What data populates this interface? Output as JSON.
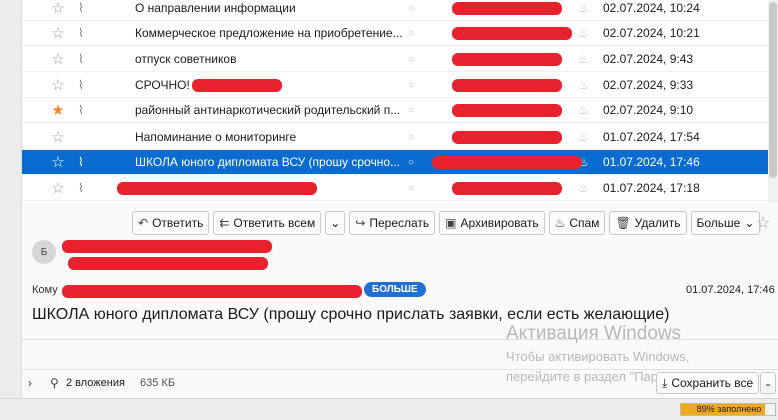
{
  "messages": [
    {
      "subject": "О направлении информации",
      "date": "02.07.2024, 10:24",
      "starred": false,
      "attachment": true,
      "selected": false
    },
    {
      "subject": "Коммерческое предложение на приобретение...",
      "date": "02.07.2024, 10:21",
      "starred": false,
      "attachment": true,
      "selected": false
    },
    {
      "subject": "отпуск советников",
      "date": "02.07.2024, 9:43",
      "starred": false,
      "attachment": true,
      "selected": false
    },
    {
      "subject": "СРОЧНО!",
      "date": "02.07.2024, 9:33",
      "starred": false,
      "attachment": true,
      "selected": false
    },
    {
      "subject": "районный антинаркотический родительский п...",
      "date": "02.07.2024, 9:10",
      "starred": true,
      "attachment": true,
      "selected": false
    },
    {
      "subject": "Напоминание о мониторинге",
      "date": "01.07.2024, 17:54",
      "starred": false,
      "attachment": false,
      "selected": false
    },
    {
      "subject": "ШКОЛА юного дипломата ВСУ (прошу срочно...",
      "date": "01.07.2024, 17:46",
      "starred": false,
      "attachment": true,
      "selected": true
    },
    {
      "subject": "",
      "date": "01.07.2024, 17:18",
      "starred": false,
      "attachment": true,
      "selected": false
    }
  ],
  "toolbar": {
    "reply": "Ответить",
    "reply_all": "Ответить всем",
    "forward": "Переслать",
    "archive": "Архивировать",
    "spam": "Спам",
    "delete": "Удалить",
    "more": "Больше"
  },
  "header": {
    "avatar_letter": "Б",
    "to_label": "Кому",
    "more_badge": "БОЛЬШЕ",
    "date": "01.07.2024, 17:46",
    "subject": "ШКОЛА юного дипломата ВСУ (прошу срочно прислать заявки, если есть желающие)"
  },
  "watermark": {
    "title": "Активация Windows",
    "line1": "Чтобы активировать Windows,",
    "line2": "перейдите в раздел \"Параметры\"."
  },
  "attachments": {
    "count_label": "2 вложения",
    "size": "635 КБ",
    "save_all": "Сохранить все"
  },
  "status": {
    "quota_label": "89% заполнено",
    "quota_fraction": 0.89
  },
  "colors": {
    "selection": "#0a6cd0",
    "star_active": "#ef8a2b",
    "redaction": "#e8222d",
    "badge": "#1e6fd8",
    "quota": "#f0a81c"
  }
}
